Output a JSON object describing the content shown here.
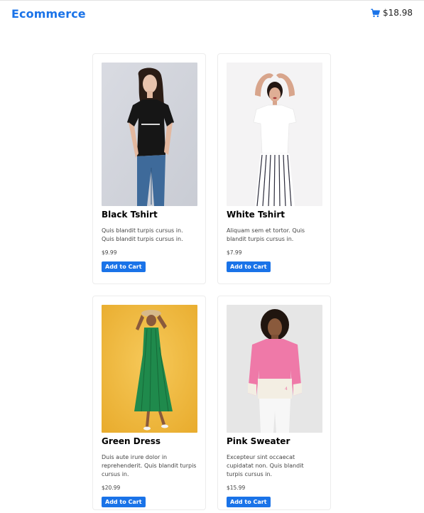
{
  "header": {
    "brand": "Ecommerce",
    "cart_total": "$18.98",
    "cart_icon": "shopping-cart-icon",
    "brand_color": "#1a73e8"
  },
  "products": [
    {
      "name": "Black Tshirt",
      "description": "Quis blandit turpis cursus in. Quis blandit turpis cursus in.",
      "price": "$9.99",
      "button_label": "Add to Cart",
      "image": "woman-black-tshirt-photo"
    },
    {
      "name": "White Tshirt",
      "description": "Aliquam sem et tortor. Quis blandit turpis cursus in.",
      "price": "$7.99",
      "button_label": "Add to Cart",
      "image": "woman-white-tshirt-photo"
    },
    {
      "name": "Green Dress",
      "description": "Duis aute irure dolor in reprehenderit. Quis blandit turpis cursus in.",
      "price": "$20.99",
      "button_label": "Add to Cart",
      "image": "woman-green-dress-photo"
    },
    {
      "name": "Pink Sweater",
      "description": "Excepteur sint occaecat cupidatat non. Quis blandit turpis cursus in.",
      "price": "$15.99",
      "button_label": "Add to Cart",
      "image": "woman-pink-sweater-photo"
    }
  ]
}
